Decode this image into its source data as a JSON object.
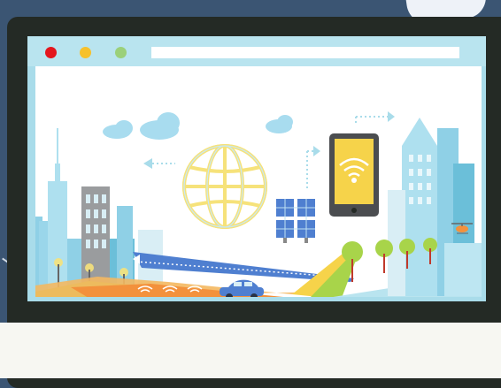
{
  "window": {
    "controls": [
      {
        "name": "close",
        "color": "#e4161d"
      },
      {
        "name": "minimize",
        "color": "#f6c12b"
      },
      {
        "name": "maximize",
        "color": "#9bd07a"
      }
    ],
    "address_bar": {
      "value": ""
    }
  },
  "illustration": {
    "icons": [
      "globe-icon",
      "tablet-icon",
      "wifi-icon",
      "solar-panel-icon",
      "car-icon",
      "cloud-icon",
      "tree-icon",
      "helicopter-icon",
      "street-lamp-icon"
    ]
  },
  "colors": {
    "background": "#3b5573",
    "monitor": "#242a25",
    "screen_frame": "#a9dcea",
    "accent_yellow": "#f6d34a"
  }
}
